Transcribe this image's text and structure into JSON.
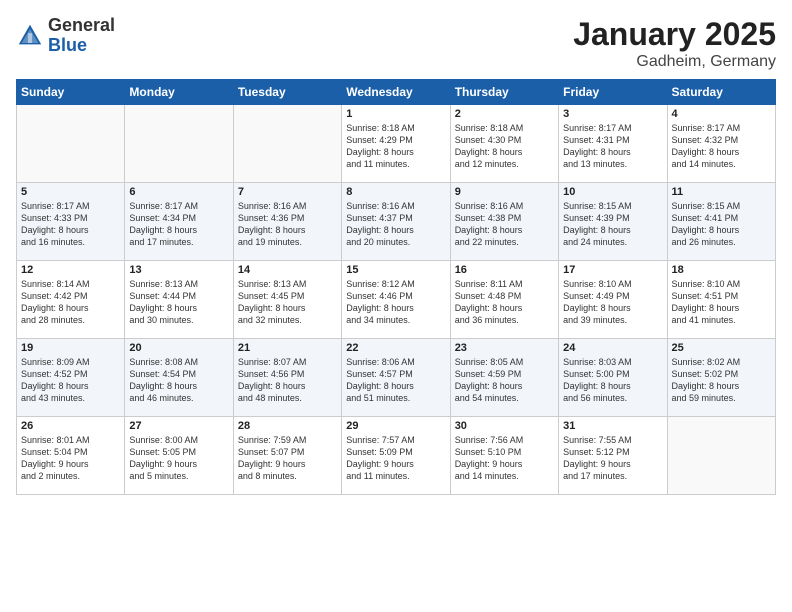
{
  "header": {
    "logo_general": "General",
    "logo_blue": "Blue",
    "month": "January 2025",
    "location": "Gadheim, Germany"
  },
  "weekdays": [
    "Sunday",
    "Monday",
    "Tuesday",
    "Wednesday",
    "Thursday",
    "Friday",
    "Saturday"
  ],
  "weeks": [
    [
      {
        "day": "",
        "info": ""
      },
      {
        "day": "",
        "info": ""
      },
      {
        "day": "",
        "info": ""
      },
      {
        "day": "1",
        "info": "Sunrise: 8:18 AM\nSunset: 4:29 PM\nDaylight: 8 hours\nand 11 minutes."
      },
      {
        "day": "2",
        "info": "Sunrise: 8:18 AM\nSunset: 4:30 PM\nDaylight: 8 hours\nand 12 minutes."
      },
      {
        "day": "3",
        "info": "Sunrise: 8:17 AM\nSunset: 4:31 PM\nDaylight: 8 hours\nand 13 minutes."
      },
      {
        "day": "4",
        "info": "Sunrise: 8:17 AM\nSunset: 4:32 PM\nDaylight: 8 hours\nand 14 minutes."
      }
    ],
    [
      {
        "day": "5",
        "info": "Sunrise: 8:17 AM\nSunset: 4:33 PM\nDaylight: 8 hours\nand 16 minutes."
      },
      {
        "day": "6",
        "info": "Sunrise: 8:17 AM\nSunset: 4:34 PM\nDaylight: 8 hours\nand 17 minutes."
      },
      {
        "day": "7",
        "info": "Sunrise: 8:16 AM\nSunset: 4:36 PM\nDaylight: 8 hours\nand 19 minutes."
      },
      {
        "day": "8",
        "info": "Sunrise: 8:16 AM\nSunset: 4:37 PM\nDaylight: 8 hours\nand 20 minutes."
      },
      {
        "day": "9",
        "info": "Sunrise: 8:16 AM\nSunset: 4:38 PM\nDaylight: 8 hours\nand 22 minutes."
      },
      {
        "day": "10",
        "info": "Sunrise: 8:15 AM\nSunset: 4:39 PM\nDaylight: 8 hours\nand 24 minutes."
      },
      {
        "day": "11",
        "info": "Sunrise: 8:15 AM\nSunset: 4:41 PM\nDaylight: 8 hours\nand 26 minutes."
      }
    ],
    [
      {
        "day": "12",
        "info": "Sunrise: 8:14 AM\nSunset: 4:42 PM\nDaylight: 8 hours\nand 28 minutes."
      },
      {
        "day": "13",
        "info": "Sunrise: 8:13 AM\nSunset: 4:44 PM\nDaylight: 8 hours\nand 30 minutes."
      },
      {
        "day": "14",
        "info": "Sunrise: 8:13 AM\nSunset: 4:45 PM\nDaylight: 8 hours\nand 32 minutes."
      },
      {
        "day": "15",
        "info": "Sunrise: 8:12 AM\nSunset: 4:46 PM\nDaylight: 8 hours\nand 34 minutes."
      },
      {
        "day": "16",
        "info": "Sunrise: 8:11 AM\nSunset: 4:48 PM\nDaylight: 8 hours\nand 36 minutes."
      },
      {
        "day": "17",
        "info": "Sunrise: 8:10 AM\nSunset: 4:49 PM\nDaylight: 8 hours\nand 39 minutes."
      },
      {
        "day": "18",
        "info": "Sunrise: 8:10 AM\nSunset: 4:51 PM\nDaylight: 8 hours\nand 41 minutes."
      }
    ],
    [
      {
        "day": "19",
        "info": "Sunrise: 8:09 AM\nSunset: 4:52 PM\nDaylight: 8 hours\nand 43 minutes."
      },
      {
        "day": "20",
        "info": "Sunrise: 8:08 AM\nSunset: 4:54 PM\nDaylight: 8 hours\nand 46 minutes."
      },
      {
        "day": "21",
        "info": "Sunrise: 8:07 AM\nSunset: 4:56 PM\nDaylight: 8 hours\nand 48 minutes."
      },
      {
        "day": "22",
        "info": "Sunrise: 8:06 AM\nSunset: 4:57 PM\nDaylight: 8 hours\nand 51 minutes."
      },
      {
        "day": "23",
        "info": "Sunrise: 8:05 AM\nSunset: 4:59 PM\nDaylight: 8 hours\nand 54 minutes."
      },
      {
        "day": "24",
        "info": "Sunrise: 8:03 AM\nSunset: 5:00 PM\nDaylight: 8 hours\nand 56 minutes."
      },
      {
        "day": "25",
        "info": "Sunrise: 8:02 AM\nSunset: 5:02 PM\nDaylight: 8 hours\nand 59 minutes."
      }
    ],
    [
      {
        "day": "26",
        "info": "Sunrise: 8:01 AM\nSunset: 5:04 PM\nDaylight: 9 hours\nand 2 minutes."
      },
      {
        "day": "27",
        "info": "Sunrise: 8:00 AM\nSunset: 5:05 PM\nDaylight: 9 hours\nand 5 minutes."
      },
      {
        "day": "28",
        "info": "Sunrise: 7:59 AM\nSunset: 5:07 PM\nDaylight: 9 hours\nand 8 minutes."
      },
      {
        "day": "29",
        "info": "Sunrise: 7:57 AM\nSunset: 5:09 PM\nDaylight: 9 hours\nand 11 minutes."
      },
      {
        "day": "30",
        "info": "Sunrise: 7:56 AM\nSunset: 5:10 PM\nDaylight: 9 hours\nand 14 minutes."
      },
      {
        "day": "31",
        "info": "Sunrise: 7:55 AM\nSunset: 5:12 PM\nDaylight: 9 hours\nand 17 minutes."
      },
      {
        "day": "",
        "info": ""
      }
    ]
  ]
}
